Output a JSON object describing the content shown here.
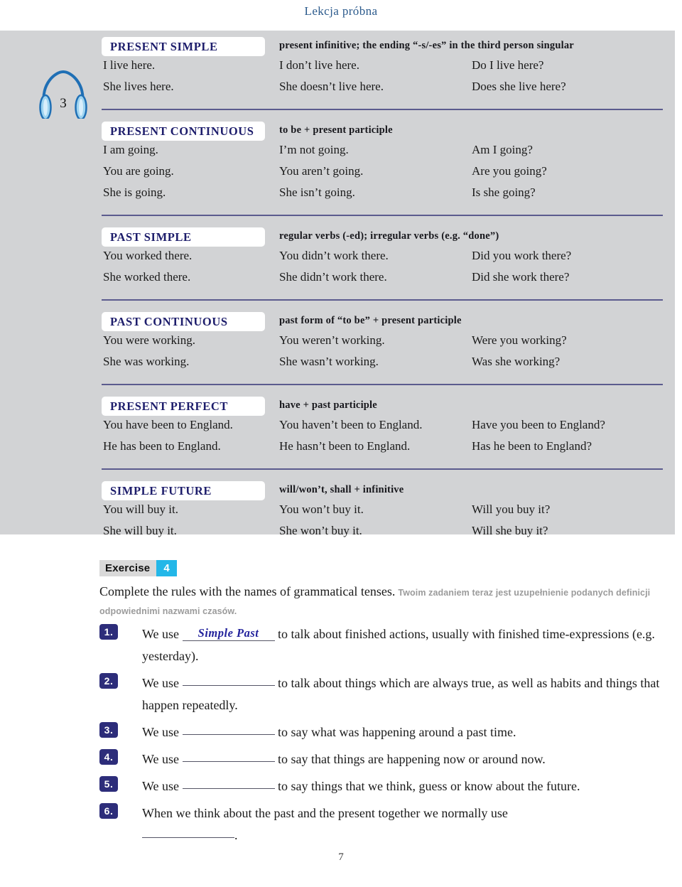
{
  "header": {
    "title": "Lekcja próbna",
    "title_color": "#2b5a8c"
  },
  "grammar_panel": {
    "background_color": "#d2d3d5",
    "audio_icon": {
      "name": "headphones-icon",
      "track_number": "3"
    },
    "tenses": [
      {
        "label": "PRESENT SIMPLE",
        "formula": "present infinitive; the ending “-s/-es” in the third person singular",
        "rows": [
          {
            "affirmative": "I live here.",
            "negative": "I don’t live here.",
            "question": "Do I live here?"
          },
          {
            "affirmative": "She lives here.",
            "negative": "She doesn’t live here.",
            "question": "Does she live here?"
          }
        ]
      },
      {
        "label": "PRESENT CONTINUOUS",
        "formula": "to be + present participle",
        "rows": [
          {
            "affirmative": "I am going.",
            "negative": "I’m not going.",
            "question": "Am I going?"
          },
          {
            "affirmative": "You are going.",
            "negative": "You aren’t going.",
            "question": "Are you going?"
          },
          {
            "affirmative": "She is going.",
            "negative": "She isn’t going.",
            "question": "Is she going?"
          }
        ]
      },
      {
        "label": "PAST SIMPLE",
        "formula": "regular verbs (-ed); irregular verbs (e.g. “done”)",
        "rows": [
          {
            "affirmative": "You worked there.",
            "negative": "You didn’t work there.",
            "question": "Did you work there?"
          },
          {
            "affirmative": "She worked there.",
            "negative": "She didn’t work there.",
            "question": "Did she work there?"
          }
        ]
      },
      {
        "label": "PAST CONTINUOUS",
        "formula": "past form of “to be” + present participle",
        "rows": [
          {
            "affirmative": "You were working.",
            "negative": "You weren’t working.",
            "question": "Were you working?"
          },
          {
            "affirmative": "She was working.",
            "negative": "She wasn’t working.",
            "question": "Was she working?"
          }
        ]
      },
      {
        "label": "PRESENT PERFECT",
        "formula": "have + past participle",
        "rows": [
          {
            "affirmative": "You have been to England.",
            "negative": "You haven’t been to England.",
            "question": "Have you been to England?"
          },
          {
            "affirmative": "He has been to England.",
            "negative": "He hasn’t been to England.",
            "question": "Has he been to England?"
          }
        ]
      },
      {
        "label": "SIMPLE FUTURE",
        "formula": "will/won’t, shall + infinitive",
        "rows": [
          {
            "affirmative": "You will buy it.",
            "negative": "You won’t buy it.",
            "question": "Will you buy it?"
          },
          {
            "affirmative": "She will buy it.",
            "negative": "She won’t buy it.",
            "question": "Will she buy it?"
          }
        ]
      }
    ]
  },
  "exercise": {
    "badge_word": "Exercise",
    "badge_number": "4",
    "badge_word_bg": "#d9d9d9",
    "badge_number_bg": "#23b7e8",
    "instruction_en": "Complete the rules with the names of grammatical tenses.",
    "instruction_pl": "Twoim zadaniem teraz jest uzupełnienie podanych definicji odpowiednimi nazwami czasów.",
    "items": [
      {
        "number": "1.",
        "text_before": "We use",
        "answer": "Simple Past",
        "text_after": "to talk about finished actions, usually with finished time-expressions (e.g. yesterday)."
      },
      {
        "number": "2.",
        "text_before": "We use",
        "answer": "",
        "text_after": "to talk about things which are always true, as well as habits and things that happen repeatedly."
      },
      {
        "number": "3.",
        "text_before": "We use",
        "answer": "",
        "text_after": "to say what was happening around a past time."
      },
      {
        "number": "4.",
        "text_before": "We use",
        "answer": "",
        "text_after": "to say that things are happening now or around now."
      },
      {
        "number": "5.",
        "text_before": "We use",
        "answer": "",
        "text_after": "to say things that we think, guess or know about the future."
      },
      {
        "number": "6.",
        "text_before": "When we think about the past and the present together we normally use",
        "answer": "",
        "text_after": "."
      }
    ]
  },
  "footer": {
    "page_number": "7"
  }
}
